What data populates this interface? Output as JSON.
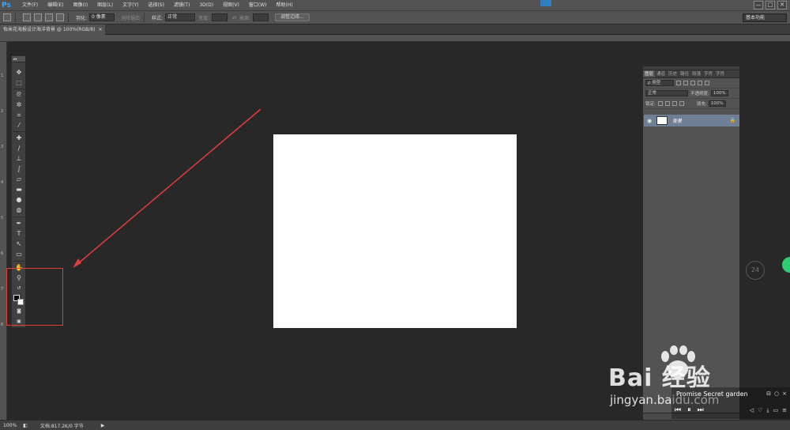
{
  "menu": {
    "logo": "Ps",
    "items": [
      "文件(F)",
      "编辑(E)",
      "图像(I)",
      "图层(L)",
      "文字(Y)",
      "选择(S)",
      "滤镜(T)",
      "3D(D)",
      "视图(V)",
      "窗口(W)",
      "帮助(H)"
    ]
  },
  "window_controls": {
    "minimize": "—",
    "restore": "□",
    "close": "✕"
  },
  "options": {
    "feather_label": "羽化:",
    "feather_value": "0 像素",
    "antialias_label": "消除锯齿",
    "style_label": "样式:",
    "style_value": "正常",
    "width_label": "宽度:",
    "height_label": "高度:",
    "refine_button": "调整边缘...",
    "workspace": "基本功能"
  },
  "document": {
    "tab_title": "怡米花海报设计海洋背景 @ 100%(RGB/8)",
    "close": "×"
  },
  "ruler_left_ticks": [
    "1",
    "2",
    "3",
    "4",
    "5",
    "6",
    "7",
    "8"
  ],
  "toolbox": {
    "header": "▸▸"
  },
  "layers_panel": {
    "tabs": [
      "图层",
      "通道",
      "历史",
      "路径",
      "段落",
      "字符",
      "字符"
    ],
    "filter_label": "ρ 类型",
    "blend_mode": "正常",
    "opacity_label": "不透明度:",
    "opacity_value": "100%",
    "lock_label": "锁定:",
    "fill_label": "填充:",
    "fill_value": "100%",
    "layer_name": "背景"
  },
  "status": {
    "zoom": "100%",
    "doc_info": "文档:817.2K/0 字节",
    "arrow": "▶"
  },
  "side_widget": {
    "value": "24"
  },
  "watermark": {
    "logo": "Bai  经验",
    "site": "jingyan.baidu.com"
  },
  "music_player": {
    "track": "Promise    Secret garden",
    "prev": "⏮",
    "play": "⏸",
    "next": "⏭"
  },
  "colors": {
    "highlight": "#e23c3c",
    "layer_selected": "#6f8096",
    "ps_blue": "#31a8ff"
  }
}
